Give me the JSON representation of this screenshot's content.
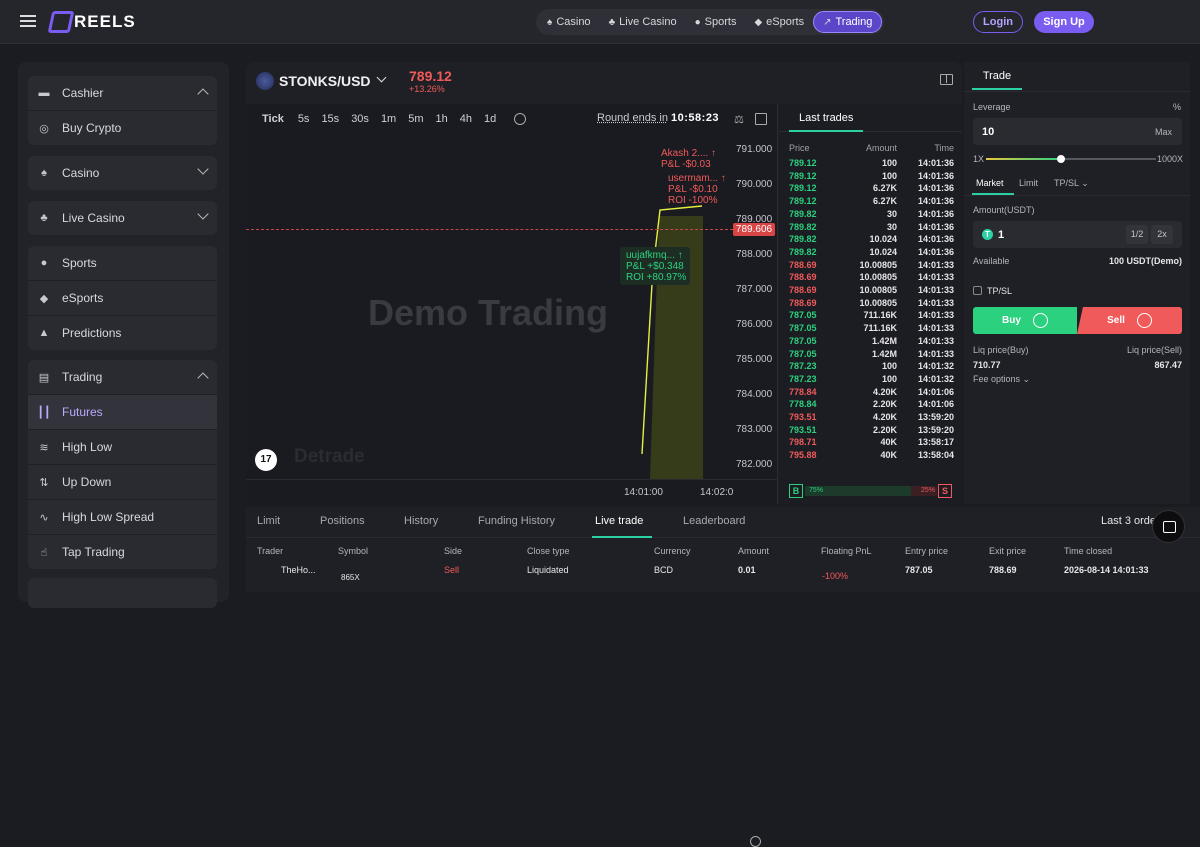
{
  "header": {
    "brand": "REELS",
    "nav": [
      "Casino",
      "Live Casino",
      "Sports",
      "eSports",
      "Trading"
    ],
    "login": "Login",
    "signup": "Sign Up"
  },
  "sidebar": {
    "cashier": "Cashier",
    "buy_crypto": "Buy Crypto",
    "casino": "Casino",
    "live_casino": "Live Casino",
    "sports": "Sports",
    "esports": "eSports",
    "predictions": "Predictions",
    "trading": "Trading",
    "futures": "Futures",
    "high_low": "High Low",
    "up_down": "Up Down",
    "high_low_spread": "High Low Spread",
    "tap_trading": "Tap Trading"
  },
  "market": {
    "pair": "STONKS/USD",
    "price": "789.12",
    "change": "+13.26%"
  },
  "chart": {
    "timeframes": [
      "Tick",
      "5s",
      "15s",
      "30s",
      "1m",
      "5m",
      "1h",
      "4h",
      "1d"
    ],
    "round_label": "Round ends in",
    "round_time": "10:58:23",
    "y_ticks": [
      "791.000",
      "790.000",
      "789.000",
      "788.000",
      "787.000",
      "786.000",
      "785.000",
      "784.000",
      "783.000",
      "782.000"
    ],
    "x_ticks": [
      "14:01:00",
      "14:02:0"
    ],
    "last_price": "789.606",
    "watermark": "Demo Trading",
    "brand": "Detrade",
    "tv": "17",
    "bubbles": [
      {
        "l1": "Akash 2.... ↑",
        "l2": "P&L -$0.03"
      },
      {
        "l1": "usermam... ↑",
        "l2": "P&L -$0.10",
        "l3": "ROI -100%"
      },
      {
        "l1": "uujafkmq... ↑",
        "l2": "P&L +$0.348",
        "l3": "ROI +80.97%"
      }
    ]
  },
  "last_trades": {
    "title": "Last trades",
    "headers": [
      "Price",
      "Amount",
      "Time"
    ],
    "rows": [
      [
        "789.12",
        "100",
        "14:01:36",
        "g"
      ],
      [
        "789.12",
        "100",
        "14:01:36",
        "g"
      ],
      [
        "789.12",
        "6.27K",
        "14:01:36",
        "g"
      ],
      [
        "789.12",
        "6.27K",
        "14:01:36",
        "g"
      ],
      [
        "789.82",
        "30",
        "14:01:36",
        "g"
      ],
      [
        "789.82",
        "30",
        "14:01:36",
        "g"
      ],
      [
        "789.82",
        "10.024",
        "14:01:36",
        "g"
      ],
      [
        "789.82",
        "10.024",
        "14:01:36",
        "g"
      ],
      [
        "788.69",
        "10.00805",
        "14:01:33",
        "r"
      ],
      [
        "788.69",
        "10.00805",
        "14:01:33",
        "r"
      ],
      [
        "788.69",
        "10.00805",
        "14:01:33",
        "r"
      ],
      [
        "788.69",
        "10.00805",
        "14:01:33",
        "r"
      ],
      [
        "787.05",
        "711.16K",
        "14:01:33",
        "g"
      ],
      [
        "787.05",
        "711.16K",
        "14:01:33",
        "g"
      ],
      [
        "787.05",
        "1.42M",
        "14:01:33",
        "g"
      ],
      [
        "787.05",
        "1.42M",
        "14:01:33",
        "g"
      ],
      [
        "787.23",
        "100",
        "14:01:32",
        "g"
      ],
      [
        "787.23",
        "100",
        "14:01:32",
        "g"
      ],
      [
        "778.84",
        "4.20K",
        "14:01:06",
        "r"
      ],
      [
        "778.84",
        "2.20K",
        "14:01:06",
        "g"
      ],
      [
        "793.51",
        "4.20K",
        "13:59:20",
        "r"
      ],
      [
        "793.51",
        "2.20K",
        "13:59:20",
        "g"
      ],
      [
        "798.71",
        "40K",
        "13:58:17",
        "r"
      ],
      [
        "795.88",
        "40K",
        "13:58:04",
        "r"
      ]
    ],
    "buy_label": "B",
    "buy_pct": "75%",
    "sell_pct": "25%",
    "sell_label": "S"
  },
  "bottom": {
    "tabs": [
      "Limit",
      "Positions",
      "History",
      "Funding History",
      "Live trade",
      "Leaderboard"
    ],
    "last_orders": "Last 3 orde",
    "columns": [
      "Trader",
      "Symbol",
      "Side",
      "Close type",
      "Currency",
      "Amount",
      "Floating PnL",
      "Entry price",
      "Exit price",
      "Time closed"
    ],
    "row": {
      "trader": "TheHo...",
      "symbol": "865X",
      "side": "Sell",
      "close_type": "Liquidated",
      "currency": "BCD",
      "amount": "0.01",
      "pnl": "-100%",
      "entry": "787.05",
      "exit": "788.69",
      "time": "2026-08-14 14:01:33"
    }
  },
  "trade_panel": {
    "tab": "Trade",
    "leverage_label": "Leverage",
    "pct": "%",
    "leverage_value": "10",
    "max": "Max",
    "min_lev": "1X",
    "max_lev": "1000X",
    "slider_fraction": 0.44,
    "order_tabs": [
      "Market",
      "Limit",
      "TP/SL"
    ],
    "amount_label": "Amount(USDT)",
    "amount_value": "1",
    "half": "1/2",
    "double": "2x",
    "available_label": "Available",
    "available_value": "100 USDT(Demo)",
    "tpsl": "TP/SL",
    "buy": "Buy",
    "sell": "Sell",
    "liq_buy_label": "Liq price(Buy)",
    "liq_sell_label": "Liq price(Sell)",
    "liq_buy": "710.77",
    "liq_sell": "867.47",
    "fee_options": "Fee options"
  }
}
